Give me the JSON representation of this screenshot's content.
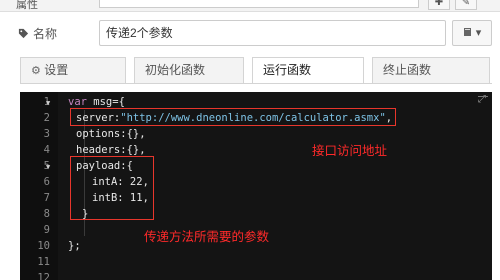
{
  "top": {
    "label": "属性",
    "btn1": "✚",
    "btn2": "✎"
  },
  "name_row": {
    "label": "名称",
    "value": "传递2个参数",
    "book_btn": "▾"
  },
  "tabs": [
    {
      "label": "设置",
      "icon": "gear-icon"
    },
    {
      "label": "初始化函数"
    },
    {
      "label": "运行函数"
    },
    {
      "label": "终止函数"
    }
  ],
  "editor": {
    "line_numbers": [
      "1",
      "2",
      "3",
      "4",
      "5",
      "6",
      "7",
      "8",
      "9",
      "10",
      "11",
      "12"
    ],
    "lines": {
      "l1_kw": "var",
      "l1_rest": " msg={",
      "l2_key": "server:",
      "l2_str": "\"http://www.dneonline.com/calculator.asmx\"",
      "l2_end": ",",
      "l3": "options:{},",
      "l4": "headers:{},",
      "l5": "payload:{",
      "l6": "intA: 22,",
      "l7": "intB: 11,",
      "l8": "}",
      "l10": "};"
    }
  },
  "annotations": {
    "note1": "接口访问地址",
    "note2": "传递方法所需要的参数"
  },
  "colors": {
    "annotation": "#ff2a2a",
    "editor_bg": "#141414",
    "string": "#7ec3e6",
    "keyword": "#c586c0"
  }
}
